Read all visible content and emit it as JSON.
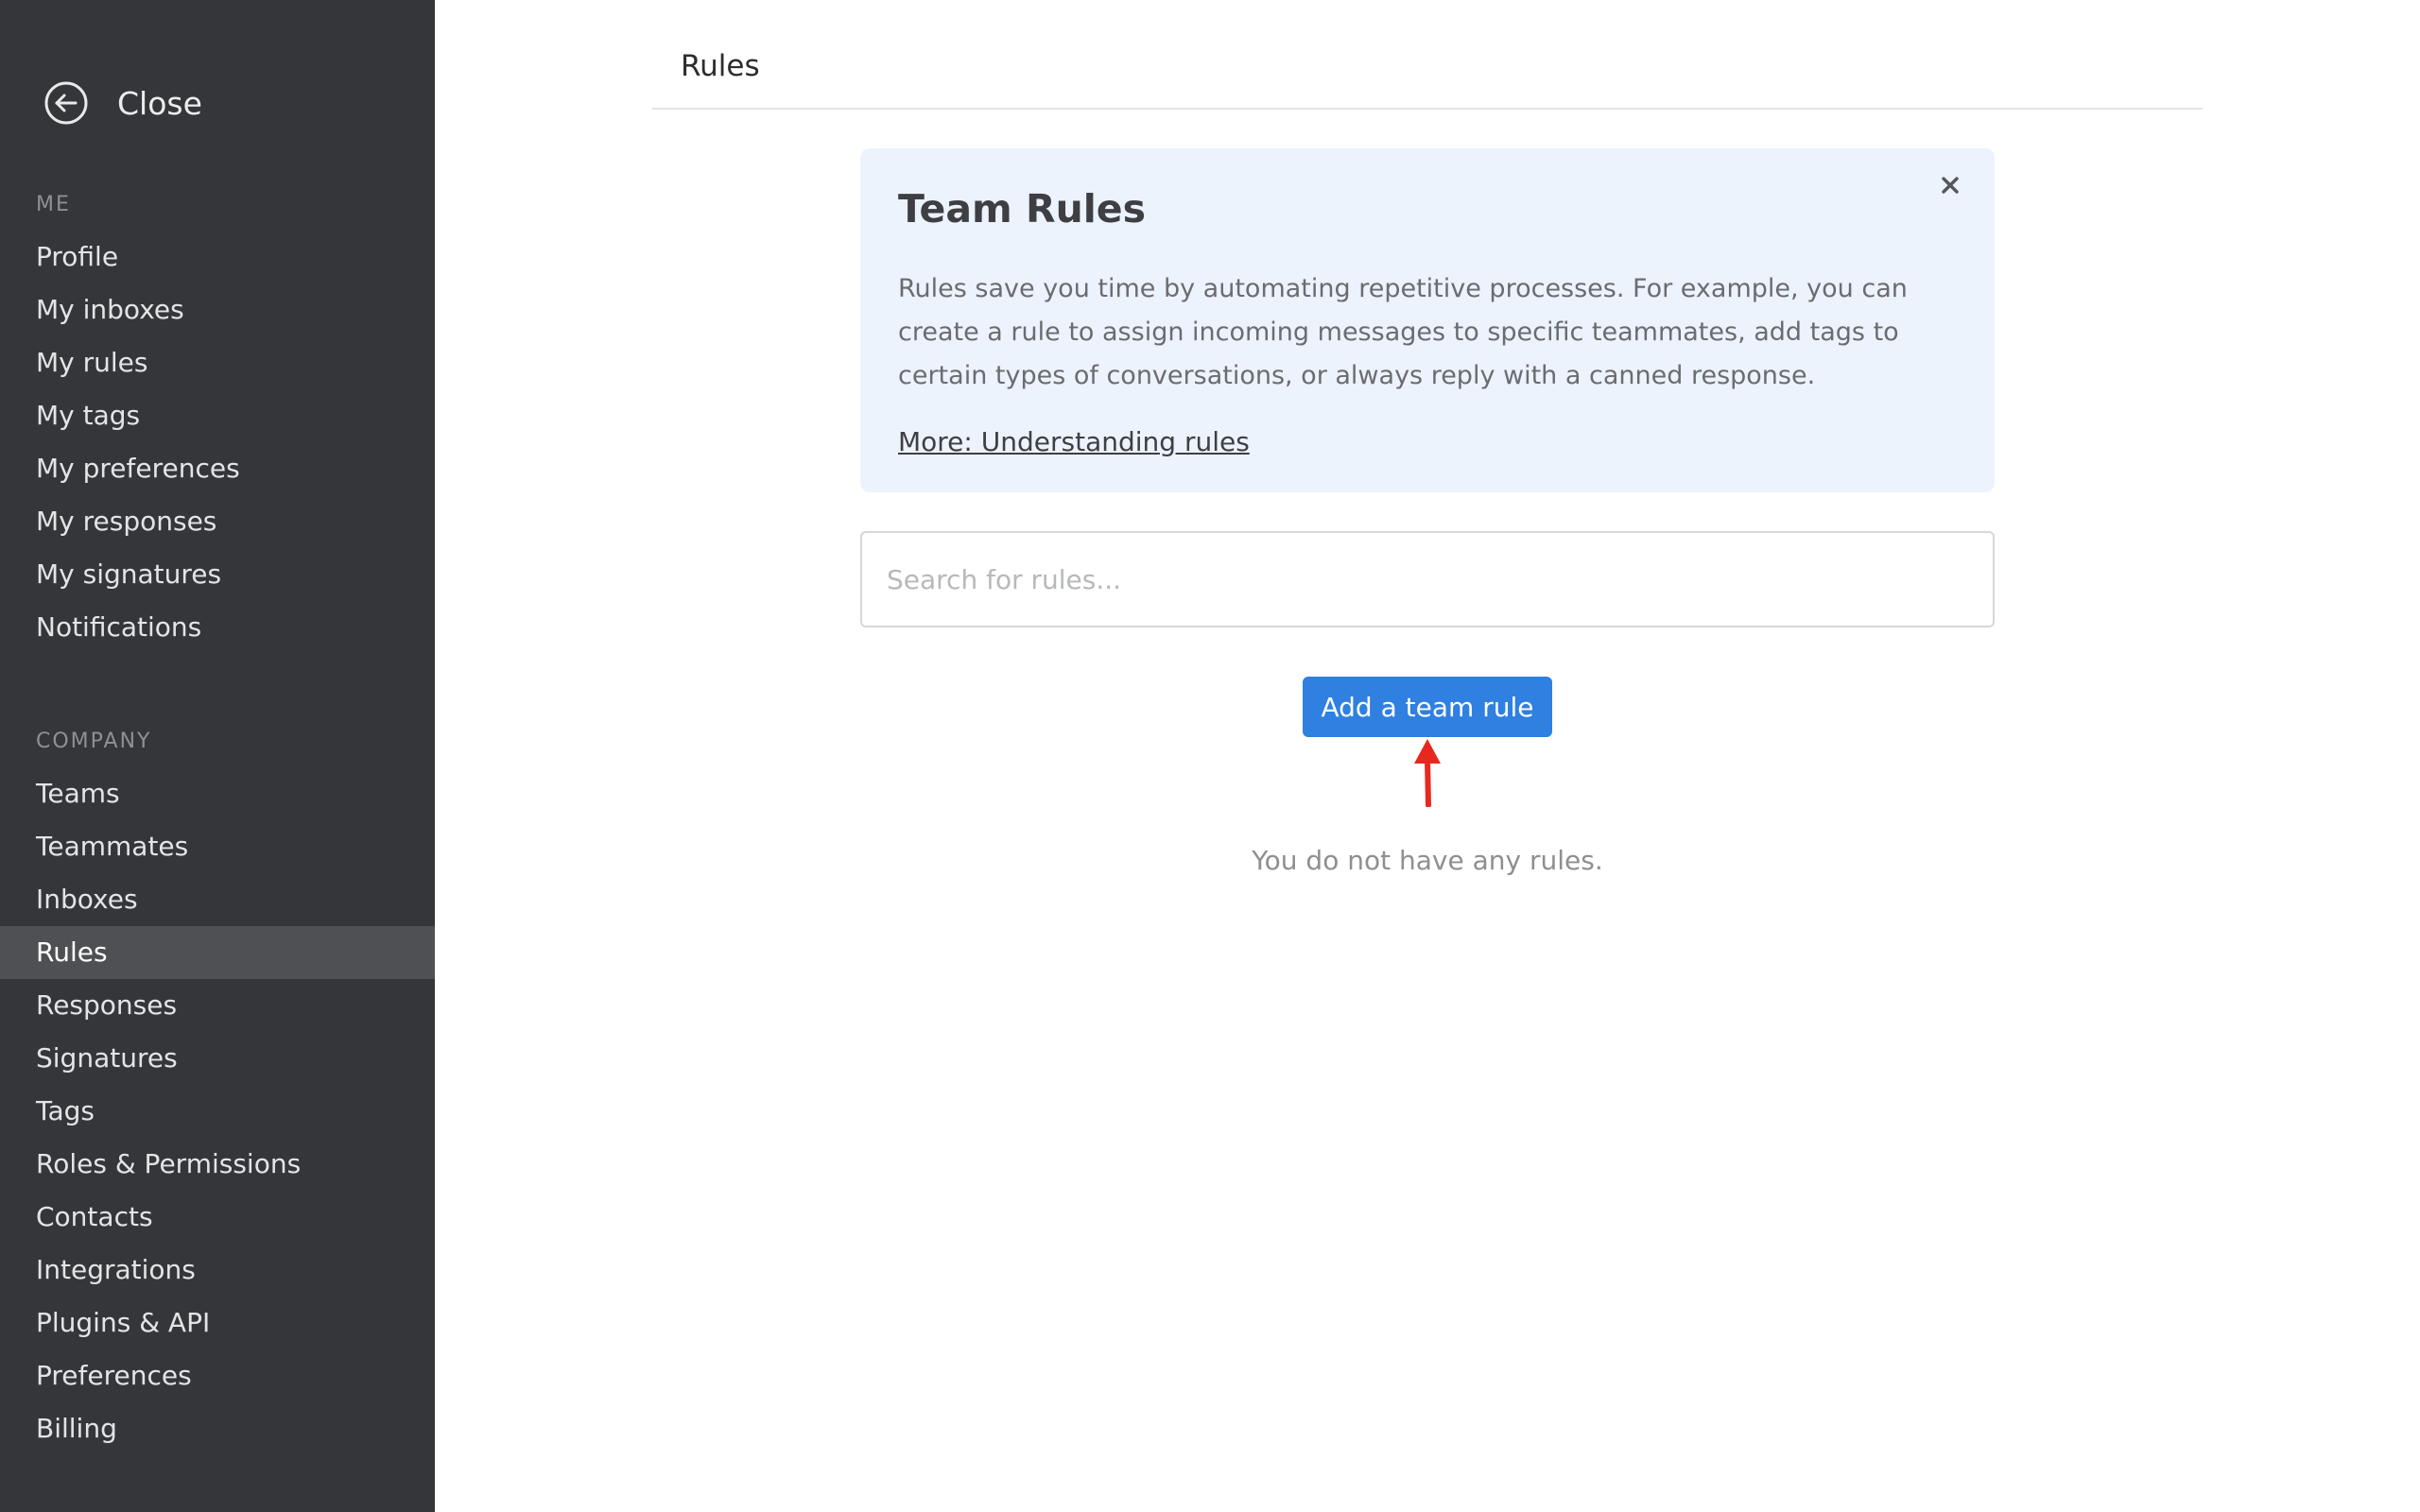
{
  "sidebar": {
    "close_label": "Close",
    "me_heading": "ME",
    "me_items": [
      {
        "label": "Profile"
      },
      {
        "label": "My inboxes"
      },
      {
        "label": "My rules"
      },
      {
        "label": "My tags"
      },
      {
        "label": "My preferences"
      },
      {
        "label": "My responses"
      },
      {
        "label": "My signatures"
      },
      {
        "label": "Notifications"
      }
    ],
    "company_heading": "COMPANY",
    "company_items": [
      {
        "label": "Teams"
      },
      {
        "label": "Teammates"
      },
      {
        "label": "Inboxes"
      },
      {
        "label": "Rules",
        "active": true
      },
      {
        "label": "Responses"
      },
      {
        "label": "Signatures"
      },
      {
        "label": "Tags"
      },
      {
        "label": "Roles & Permissions"
      },
      {
        "label": "Contacts"
      },
      {
        "label": "Integrations"
      },
      {
        "label": "Plugins & API"
      },
      {
        "label": "Preferences"
      },
      {
        "label": "Billing"
      }
    ]
  },
  "header": {
    "title": "Rules"
  },
  "info_card": {
    "title": "Team Rules",
    "body": "Rules save you time by automating repetitive processes. For example, you can create a rule to assign incoming messages to specific teammates, add tags to certain types of conversations, or always reply with a canned response.",
    "link_label": "More: Understanding rules"
  },
  "search": {
    "placeholder": "Search for rules...",
    "value": ""
  },
  "actions": {
    "add_rule_label": "Add a team rule"
  },
  "empty_state": {
    "message": "You do not have any rules."
  },
  "colors": {
    "sidebar_bg": "#35363a",
    "sidebar_active_bg": "#4f5054",
    "accent": "#2f80e0",
    "info_bg": "#ecf3fd",
    "annotation_arrow": "#e8281e"
  },
  "icons": {
    "close": "arrow-left-circle-icon",
    "dismiss": "x-close-icon"
  }
}
